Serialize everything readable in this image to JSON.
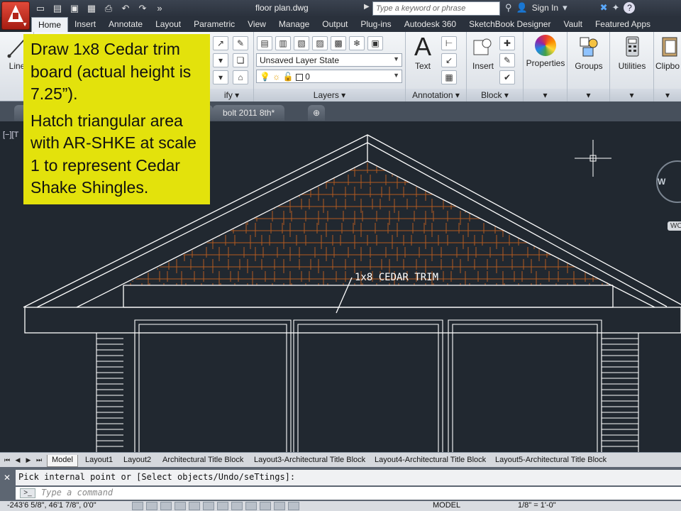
{
  "titlebar": {
    "title": "floor plan.dwg",
    "search_placeholder": "Type a keyword or phrase",
    "sign_in": "Sign In",
    "help": "?"
  },
  "ribbon_tabs": [
    "Home",
    "Insert",
    "Annotate",
    "Layout",
    "Parametric",
    "View",
    "Manage",
    "Output",
    "Plug-ins",
    "Autodesk 360",
    "SketchBook Designer",
    "Vault",
    "Featured Apps"
  ],
  "ribbon": {
    "line_label": "Line",
    "modify_label": "ify",
    "layer_state": "Unsaved Layer State",
    "layer_current": "0",
    "layers_panel": "Layers",
    "text_label": "Text",
    "annotation_panel": "Annotation",
    "insert_label": "Insert",
    "block_panel": "Block",
    "properties_label": "Properties",
    "groups_label": "Groups",
    "utilities_label": "Utilities",
    "clipboard_label": "Clipbo",
    "text_icon_glyph": "A"
  },
  "doc_tabs": {
    "tab1": "bolt 2011 8th*"
  },
  "viewport": {
    "label": "[−][T",
    "callout_text": "1x8 CEDAR TRIM",
    "viewcube_letter": "W",
    "wcs_label": "WC"
  },
  "layout_tabs": [
    "Model",
    "Layout1",
    "Layout2",
    "Architectural Title Block",
    "Layout3-Architectural Title Block",
    "Layout4-Architectural Title Block",
    "Layout5-Architectural Title Block"
  ],
  "command": {
    "history": "Pick internal point or [Select objects/Undo/seTtings]:",
    "placeholder": "Type a command",
    "prompt_icon": ">_"
  },
  "status": {
    "coords": "-243'6 5/8\", 46'1 7/8\", 0'0\"",
    "model": "MODEL",
    "scale": "1/8\" = 1'-0\""
  },
  "note": {
    "line1": "Draw 1x8 Cedar trim board (actual height is 7.25”).",
    "line2": "Hatch triangular area with AR-SHKE at scale 1 to represent Cedar Shake Shingles."
  },
  "colors": {
    "canvas": "#212830",
    "note_bg": "#e3e20c",
    "hatch": "#b35a1f",
    "lines": "#ffffff"
  }
}
